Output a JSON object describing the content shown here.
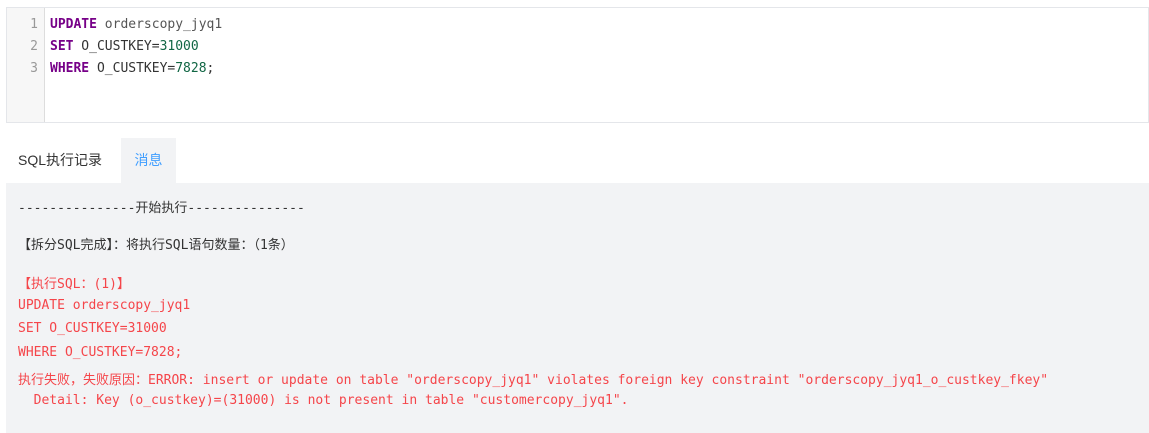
{
  "editor": {
    "line_numbers": [
      "1",
      "2",
      "3"
    ],
    "lines": [
      {
        "kw": "UPDATE",
        "rest": " orderscopy_jyq1",
        "num": "",
        "tail": ""
      },
      {
        "kw": "SET",
        "rest": " O_CUSTKEY=",
        "num": "31000",
        "tail": ""
      },
      {
        "kw": "WHERE",
        "rest": " O_CUSTKEY=",
        "num": "7828",
        "tail": ";"
      }
    ]
  },
  "tabs": [
    {
      "label": "SQL执行记录",
      "active": false
    },
    {
      "label": "消息",
      "active": true
    }
  ],
  "messages": {
    "start": "---------------开始执行---------------",
    "split": "【拆分SQL完成】：将执行SQL语句数量：（1条）",
    "exec_header": "【执行SQL：(1)】",
    "sql_lines": [
      "UPDATE orderscopy_jyq1",
      "SET O_CUSTKEY=31000",
      "WHERE O_CUSTKEY=7828;"
    ],
    "error": "执行失败，失败原因：ERROR: insert or update on table \"orderscopy_jyq1\" violates foreign key constraint \"orderscopy_jyq1_o_custkey_fkey\"",
    "detail": "  Detail: Key (o_custkey)=(31000) is not present in table \"customercopy_jyq1\"."
  },
  "colors": {
    "keyword": "#770088",
    "number": "#116644",
    "error_text": "#f5454a",
    "active_tab": "#409eff",
    "panel_bg": "#f2f3f5"
  }
}
